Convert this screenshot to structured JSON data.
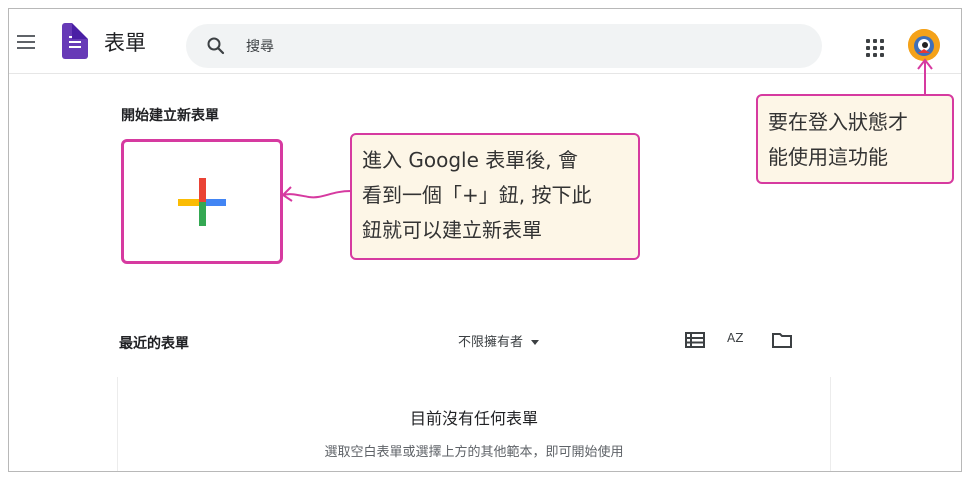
{
  "header": {
    "app_title": "表單",
    "search_placeholder": "搜尋"
  },
  "start_section": {
    "title": "開始建立新表單"
  },
  "annotations": {
    "plus_callout": [
      "進入 Google 表單後, 會",
      "看到一個「+」鈕, 按下此",
      "鈕就可以建立新表單"
    ],
    "login_callout": [
      "要在登入狀態才",
      "能使用這功能"
    ],
    "accent_color": "#d63aa0",
    "callout_bg": "#fdf6e7"
  },
  "recent_section": {
    "title": "最近的表單",
    "owner_filter": "不限擁有者",
    "sort_label": "AZ"
  },
  "empty_state": {
    "title": "目前沒有任何表單",
    "subtitle": "選取空白表單或選擇上方的其他範本，即可開始使用"
  },
  "icons": [
    "menu-icon",
    "forms-logo-icon",
    "search-icon",
    "apps-grid-icon",
    "avatar",
    "list-view-icon",
    "sort-az-icon",
    "folder-icon"
  ]
}
